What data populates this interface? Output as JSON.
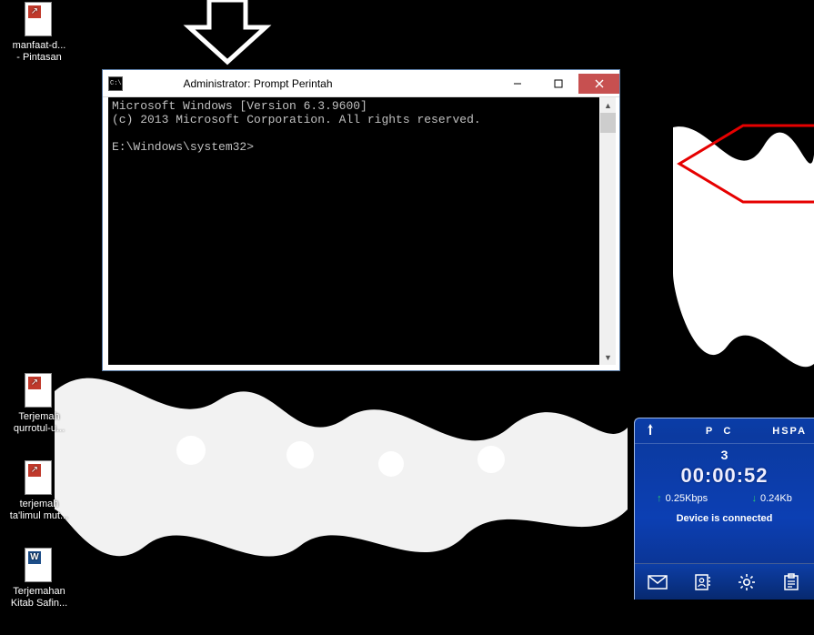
{
  "desktop_icons": [
    {
      "label": "manfaat-d...\n- Pintasan",
      "type": "shortcut"
    },
    {
      "label": "Terjemah\nqurrotul-u...",
      "type": "shortcut"
    },
    {
      "label": "terjemah\nta'limul mut...",
      "type": "shortcut"
    },
    {
      "label": "Terjemahan\nKitab Safin...",
      "type": "word"
    }
  ],
  "cmd": {
    "title": "Administrator: Prompt Perintah",
    "line1": "Microsoft Windows [Version 6.3.9600]",
    "line2": "(c) 2013 Microsoft Corporation. All rights reserved.",
    "prompt": "E:\\Windows\\system32>"
  },
  "modem": {
    "mode1": "P",
    "mode2": "C",
    "net": "HSPA",
    "signal_bars": "3",
    "timer": "00:00:52",
    "up": "0.25Kbps",
    "down": "0.24Kb",
    "status": "Device is connected"
  },
  "annotations": {
    "down_arrow": "down-arrow",
    "red_arrow": "red-arrow"
  }
}
